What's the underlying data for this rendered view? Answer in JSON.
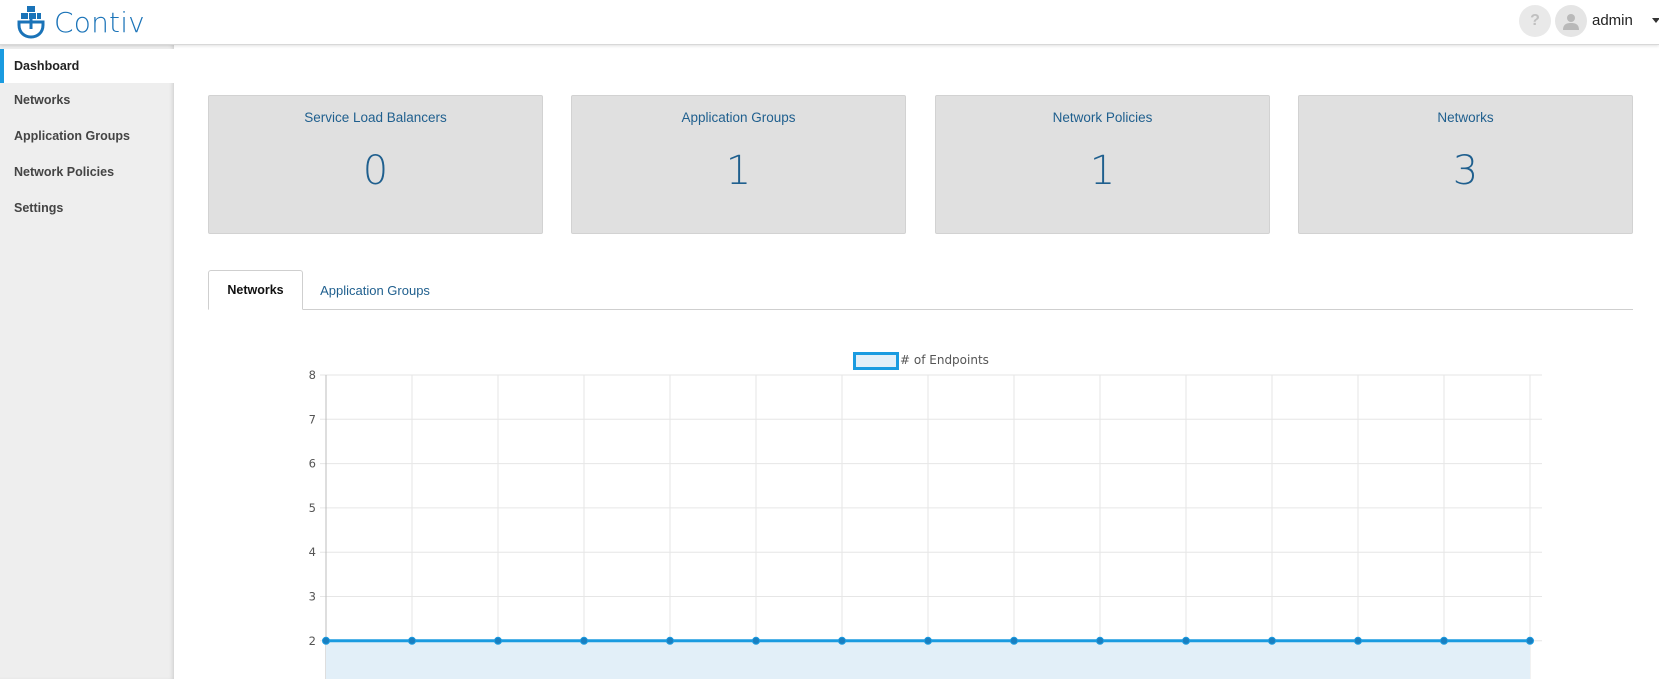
{
  "app": {
    "title": "Contiv",
    "help_icon": "question-icon",
    "user": "admin"
  },
  "sidebar": {
    "items": [
      {
        "label": "Dashboard",
        "active": true
      },
      {
        "label": "Networks",
        "active": false
      },
      {
        "label": "Application Groups",
        "active": false
      },
      {
        "label": "Network Policies",
        "active": false
      },
      {
        "label": "Settings",
        "active": false
      }
    ]
  },
  "cards": [
    {
      "title": "Service Load Balancers",
      "value": "0"
    },
    {
      "title": "Application Groups",
      "value": "1"
    },
    {
      "title": "Network Policies",
      "value": "1"
    },
    {
      "title": "Networks",
      "value": "3"
    }
  ],
  "tabs": [
    {
      "label": "Networks",
      "active": true
    },
    {
      "label": "Application Groups",
      "active": false
    }
  ],
  "colors": {
    "brand": "#1a73b8",
    "accent": "#1a9be0",
    "card_bg": "#e0e0e0",
    "sidebar_bg": "#eeeeee"
  },
  "chart_data": {
    "type": "line",
    "legend": "# of Endpoints",
    "legend_position": "top",
    "y_ticks_visible": [
      "8",
      "7",
      "6",
      "5",
      "4",
      "3",
      "2"
    ],
    "ylim": [
      2,
      8
    ],
    "grid": true,
    "fill": true,
    "series": [
      {
        "name": "# of Endpoints",
        "values": [
          2,
          2,
          2,
          2,
          2,
          2,
          2,
          2,
          2,
          2,
          2,
          2,
          2,
          2,
          2
        ]
      }
    ]
  }
}
